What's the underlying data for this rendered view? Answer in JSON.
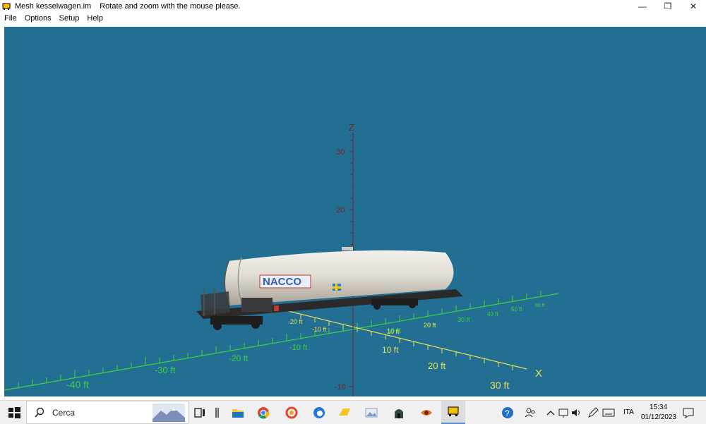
{
  "window": {
    "title": "Mesh kesselwagen.im",
    "subtitle": "Rotate and zoom with the mouse please.",
    "controls": {
      "minimize": "—",
      "restore": "❐",
      "close": "✕"
    }
  },
  "menu": [
    "File",
    "Options",
    "Setup",
    "Help"
  ],
  "viewport": {
    "background": "#236f94",
    "axes": {
      "z_label": "Z",
      "x_label": "X",
      "z_ticks": [
        "30",
        "20",
        "-10"
      ],
      "x_ticks_green": [
        "10 ft",
        "20 ft",
        "30 ft"
      ],
      "y_ticks_green": [
        "-10 ft",
        "-20 ft",
        "-30 ft",
        "-40 ft"
      ],
      "far_ticks_green": [
        "20 ft",
        "30 ft",
        "40 ft",
        "50 ft",
        "60 ft"
      ],
      "near_ticks_orange": [
        "-20 ft",
        "-10 ft",
        "10 ft",
        "20 ft"
      ]
    },
    "model": {
      "brand_text": "NACCO"
    }
  },
  "taskbar": {
    "search_placeholder": "Cerca",
    "language": "ITA",
    "time": "15:34",
    "date": "01/12/2023"
  }
}
